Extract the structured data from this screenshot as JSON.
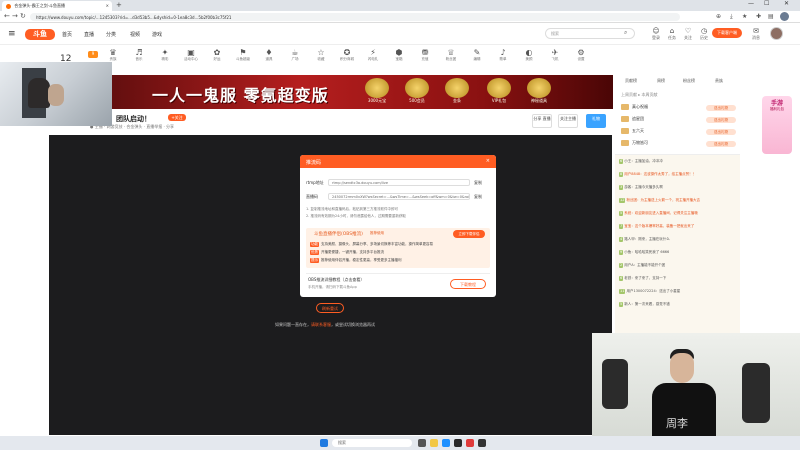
{
  "browser": {
    "tab_title": "合金弹头-霸王之剑·斗鱼直播",
    "tab_close": "×",
    "new_tab": "+",
    "url": "https://www.douyu.com/topic/...1245303?rid=...d3d53b5...&dyshid=0-1ea8c3d...5b2f00b3c75f21",
    "win_min": "—",
    "win_max": "☐",
    "win_close": "✕"
  },
  "site": {
    "logo": "斗鱼",
    "nav": [
      "首页",
      "直播",
      "分类",
      "视频",
      "游戏"
    ],
    "search_placeholder": "搜索",
    "search_icon": "⌕",
    "header_icons": [
      {
        "glyph": "☺",
        "label": "登录"
      },
      {
        "glyph": "⌂",
        "label": "任务"
      },
      {
        "glyph": "♡",
        "label": "关注"
      },
      {
        "glyph": "◷",
        "label": "历史"
      },
      {
        "glyph": "✉",
        "label": "消息"
      }
    ],
    "download_btn": "下载客户端"
  },
  "room": {
    "number": "12",
    "level": "9",
    "title": "团队启动！",
    "follow": "+关注",
    "subline": "● 主播 · 网游竞技 · 合金弹头 · 直播举报 · 分享",
    "buttons": [
      "分享\n直播",
      "关注主播",
      "礼物"
    ]
  },
  "categories": [
    {
      "glyph": "♛",
      "label": "贵族"
    },
    {
      "glyph": "♬",
      "label": "音乐"
    },
    {
      "glyph": "✦",
      "label": "精彩"
    },
    {
      "glyph": "▣",
      "label": "活动中心"
    },
    {
      "glyph": "✿",
      "label": "好运"
    },
    {
      "glyph": "⚑",
      "label": "斗鱼超级"
    },
    {
      "glyph": "♦",
      "label": "道具"
    },
    {
      "glyph": "☕",
      "label": "广场"
    },
    {
      "glyph": "☆",
      "label": "收藏"
    },
    {
      "glyph": "✪",
      "label": "积分商城"
    },
    {
      "glyph": "⚡",
      "label": "闪电礼"
    },
    {
      "glyph": "⬢",
      "label": "宝箱"
    },
    {
      "glyph": "⛃",
      "label": "充值"
    },
    {
      "glyph": "♕",
      "label": "粉丝团"
    },
    {
      "glyph": "✎",
      "label": "编辑"
    },
    {
      "glyph": "♪",
      "label": "歌单"
    },
    {
      "glyph": "◐",
      "label": "美颜"
    },
    {
      "glyph": "✈",
      "label": "飞机"
    },
    {
      "glyph": "⚙",
      "label": "设置"
    }
  ],
  "banner": {
    "text": "一人一鬼服  零氪超变版",
    "prizes": [
      "3000元宝",
      "500会员",
      "金条",
      "VIP礼包",
      "神秘道具"
    ]
  },
  "dialog": {
    "title": "推流码",
    "close": "×",
    "url_label": "rtmp地址",
    "url_value": "rtmp://sendtc3a.douyu.com/live",
    "code_label": "直播码",
    "code_value": "2450072rmm0vXW?wsSecret=...&wsTime=...&wsSeek=off&wm=0&tw=0&roirecognition=0&record=flv&origin=tct&txHost=sendtc3a.douyu.com",
    "copy": "复制",
    "note1": "1. 复制推流地址和直播码后，粘贴到第三方推流软件中即可",
    "note2": "2. 推流码有效期为24小时，请勿泄露给他人，过期需要重新获取",
    "warn_title": "斗鱼直播伴侣(OBS推流)",
    "warn_badge": "推荐使用",
    "warn_btn": "立即下载伴侣",
    "warn_items": [
      {
        "tag": "功能",
        "text": "支持美颜、摄像头、屏幕分享、多场景切换等丰富功能，操作简单更容易"
      },
      {
        "tag": "优势",
        "text": "开播更便捷，一键开播，支持多平台推流"
      },
      {
        "tag": "提示",
        "text": "推荐使用伴侣开播，稳定性更高，享受更多主播福利"
      }
    ],
    "mobile_title": "OBS推流详细教程（点击查看）",
    "mobile_sub": "手机开播，请扫码下载斗鱼App",
    "mobile_btn": "下载教程"
  },
  "player": {
    "retry": "刷新重试",
    "hint_pre": "如果问题一直存在，",
    "hint_link": "请联系客服",
    "hint_post": "，或尝试切换浏览器再试"
  },
  "rank": {
    "tabs": [
      "贡献榜",
      "周榜",
      "粉丝榜",
      "贵族"
    ],
    "filter": "上周贡献 ▸ 本周贡献",
    "rows": [
      {
        "name": "真心祝福",
        "badge": "送出礼物"
      },
      {
        "name": "追星团",
        "badge": "送出礼物"
      },
      {
        "name": "五六天",
        "badge": "送出礼物"
      },
      {
        "name": "万物皆可",
        "badge": "送出礼物"
      }
    ]
  },
  "chat": [
    {
      "badge": "6",
      "text": "小王：主播加油，冲冲冲",
      "hl": false
    },
    {
      "badge": "8",
      "text": "用户8848：这波操作太秀了，给主播点赞！！",
      "hl": true
    },
    {
      "badge": "3",
      "text": "游客：主播今天播多久啊",
      "hl": false
    },
    {
      "badge": "12",
      "text": "粉丝团：为主播送上火箭一个，祝主播开播大吉",
      "hl": true
    },
    {
      "badge": "5",
      "text": "系统：欢迎新朋友进入直播间，记得关注主播哦",
      "hl": true
    },
    {
      "badge": "7",
      "text": "宝宝：这个版本爆率好高，装备一把就出来了",
      "hl": true
    },
    {
      "badge": "4",
      "text": "路人甲：刚来，主播在玩什么",
      "hl": false
    },
    {
      "badge": "9",
      "text": "小鱼：哈哈哈笑死我了 6666",
      "hl": false
    },
    {
      "badge": "2",
      "text": "用户A：主播能不能开个团",
      "hl": false
    },
    {
      "badge": "6",
      "text": "老铁：来了来了，支持一下",
      "hl": false
    },
    {
      "badge": "11",
      "text": "用户1300072224：送出了小星星",
      "hl": false
    },
    {
      "badge": "5",
      "text": "新人：第一次来看，感觉不错",
      "hl": false
    }
  ],
  "promo": {
    "title": "手游",
    "sub": "福利礼包"
  },
  "shirt_text": "周李",
  "taskbar": {
    "search": "搜索"
  },
  "colors": {
    "brand": "#ff5d23",
    "player_bg": "#1c1c1e"
  }
}
